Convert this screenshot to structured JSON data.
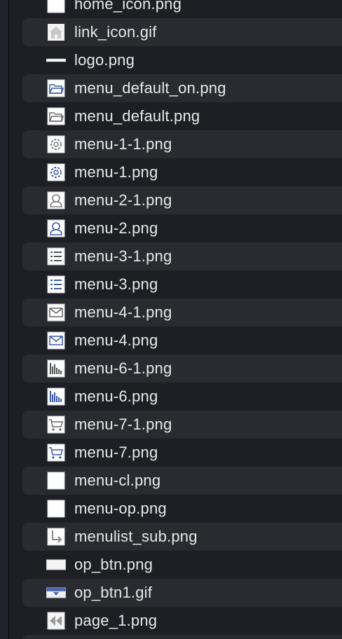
{
  "files": [
    {
      "name": "home_icon.png",
      "icon": "blank-page-icon"
    },
    {
      "name": "link_icon.gif",
      "icon": "home-icon"
    },
    {
      "name": "logo.png",
      "icon": "logo-strip-icon"
    },
    {
      "name": "menu_default_on.png",
      "icon": "folder-icon"
    },
    {
      "name": "menu_default.png",
      "icon": "folder-icon"
    },
    {
      "name": "menu-1-1.png",
      "icon": "gear-icon"
    },
    {
      "name": "menu-1.png",
      "icon": "gear-icon"
    },
    {
      "name": "menu-2-1.png",
      "icon": "user-icon"
    },
    {
      "name": "menu-2.png",
      "icon": "user-icon"
    },
    {
      "name": "menu-3-1.png",
      "icon": "list-icon"
    },
    {
      "name": "menu-3.png",
      "icon": "list-icon"
    },
    {
      "name": "menu-4-1.png",
      "icon": "mail-icon"
    },
    {
      "name": "menu-4.png",
      "icon": "mail-icon"
    },
    {
      "name": "menu-6-1.png",
      "icon": "bar-chart-icon"
    },
    {
      "name": "menu-6.png",
      "icon": "bar-chart-icon"
    },
    {
      "name": "menu-7-1.png",
      "icon": "cart-icon"
    },
    {
      "name": "menu-7.png",
      "icon": "cart-icon"
    },
    {
      "name": "menu-cl.png",
      "icon": "blank-page-icon"
    },
    {
      "name": "menu-op.png",
      "icon": "blank-page-icon"
    },
    {
      "name": "menulist_sub.png",
      "icon": "sub-arrow-icon"
    },
    {
      "name": "op_btn.png",
      "icon": "button-icon"
    },
    {
      "name": "op_btn1.gif",
      "icon": "dropdown-button-icon"
    },
    {
      "name": "page_1.png",
      "icon": "rewind-icon"
    }
  ]
}
